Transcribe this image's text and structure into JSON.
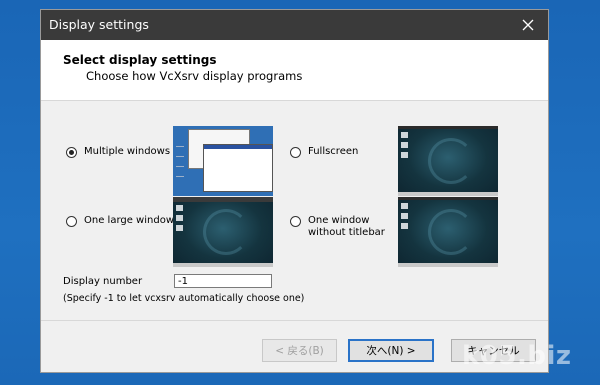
{
  "window": {
    "title": "Display settings"
  },
  "header": {
    "title": "Select display settings",
    "subtitle": "Choose how VcXsrv display programs"
  },
  "options": [
    {
      "label": "Multiple windows",
      "selected": true
    },
    {
      "label": "Fullscreen",
      "selected": false
    },
    {
      "label": "One large window",
      "selected": false
    },
    {
      "label": "One window\nwithout titlebar",
      "selected": false
    }
  ],
  "display_number": {
    "label": "Display number",
    "value": "-1",
    "hint": "(Specify -1 to let vcxsrv automatically choose one)"
  },
  "buttons": {
    "back": "< 戻る(B)",
    "next": "次へ(N) >",
    "cancel": "キャンセル"
  },
  "watermark": "k05.biz",
  "colors": {
    "desktop": "#1f6fbe",
    "titlebar": "#3a3a3a",
    "accent": "#2a73c8"
  }
}
